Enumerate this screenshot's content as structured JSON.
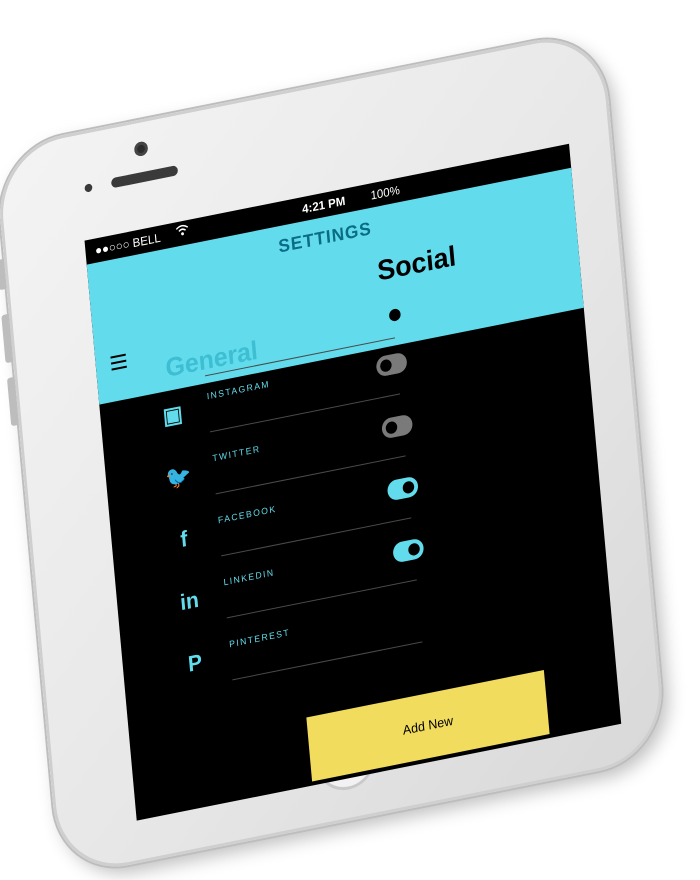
{
  "status_bar": {
    "carrier": "●●○○○ BELL",
    "time": "4:21 PM",
    "battery": "100%"
  },
  "header": {
    "title": "SETTINGS",
    "tabs": [
      {
        "label": "General",
        "active": false
      },
      {
        "label": "Social",
        "active": true
      }
    ]
  },
  "first_toggle": {
    "state": "on"
  },
  "socials": [
    {
      "icon": "instagram-icon",
      "glyph": "▣",
      "label": "INSTAGRAM",
      "toggle": "off"
    },
    {
      "icon": "twitter-icon",
      "glyph": "🐦",
      "label": "TWITTER",
      "toggle": "off"
    },
    {
      "icon": "facebook-icon",
      "glyph": "f",
      "label": "FACEBOOK",
      "toggle": "on"
    },
    {
      "icon": "linkedin-icon",
      "glyph": "in",
      "label": "LINKEDIN",
      "toggle": "on"
    },
    {
      "icon": "pinterest-icon",
      "glyph": "P",
      "label": "PINTEREST",
      "toggle": null
    }
  ],
  "add_button": "Add New",
  "colors": {
    "accent": "#62dcec",
    "button": "#f2dc5d",
    "background": "#000000"
  }
}
